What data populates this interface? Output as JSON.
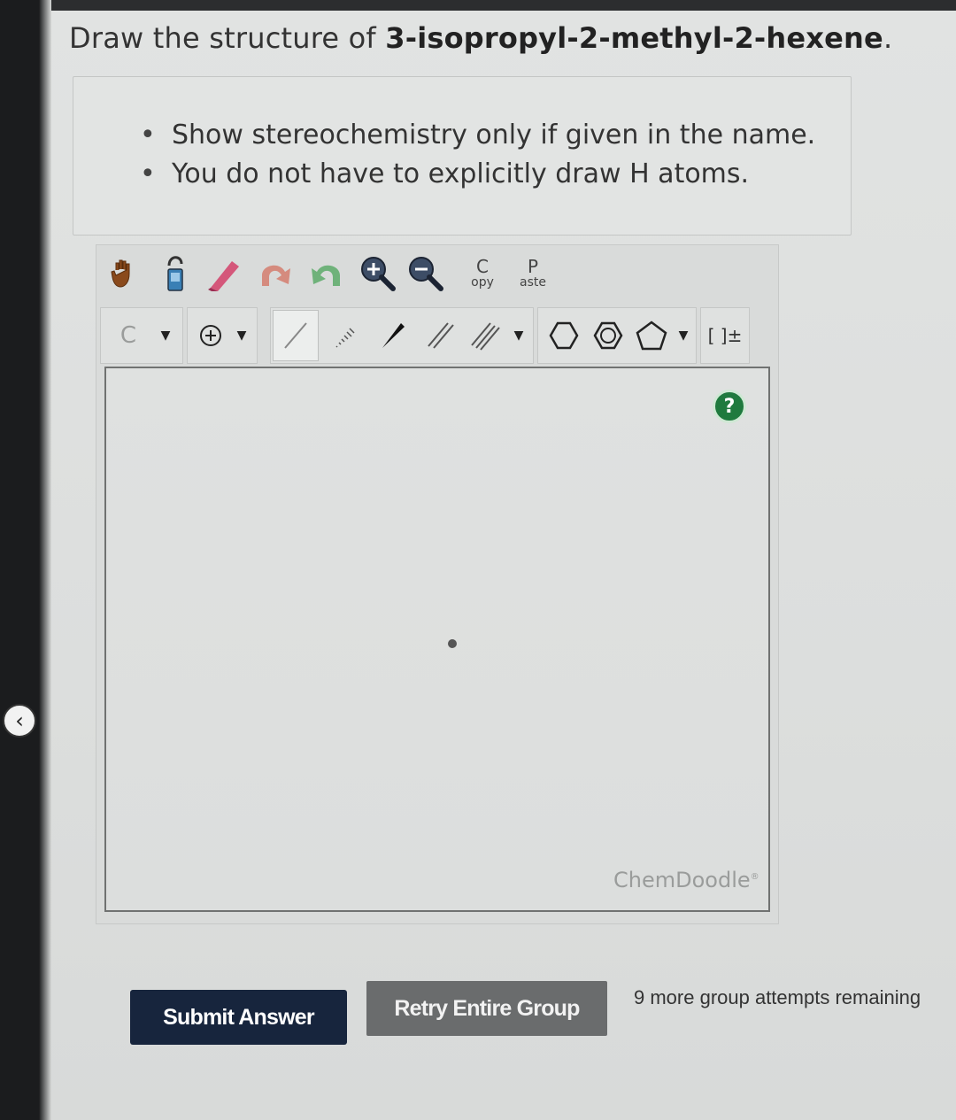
{
  "question": {
    "prefix": "Draw the structure of ",
    "compound": "3-isopropyl-2-methyl-2-hexene",
    "suffix": "."
  },
  "instructions": [
    "Show stereochemistry only if given in the name.",
    "You do not have to explicitly draw H atoms."
  ],
  "toolbar": {
    "copy_label_top": "C",
    "copy_label_bottom": "opy",
    "paste_label_top": "P",
    "paste_label_bottom": "aste",
    "atom_selector": "C",
    "charge_bracket": "[ ]±",
    "icons": [
      "hand-icon",
      "lasso-icon",
      "eraser-icon",
      "undo-icon",
      "redo-icon",
      "zoom-in-icon",
      "zoom-out-icon",
      "charge-plus-icon",
      "single-bond-icon",
      "hashed-bond-icon",
      "wedge-bond-icon",
      "double-bond-icon",
      "triple-bond-icon",
      "cyclohexane-icon",
      "benzene-icon",
      "cyclopentane-icon",
      "bracket-charge-icon"
    ]
  },
  "canvas": {
    "help_label": "?",
    "brand": "ChemDoodle"
  },
  "actions": {
    "submit_label": "Submit Answer",
    "retry_label": "Retry Entire Group",
    "attempts_text": "9 more group attempts remaining"
  },
  "colors": {
    "submit_bg": "#17253d",
    "retry_bg": "#6a6c6d",
    "help_bg": "#1f7a3e"
  }
}
